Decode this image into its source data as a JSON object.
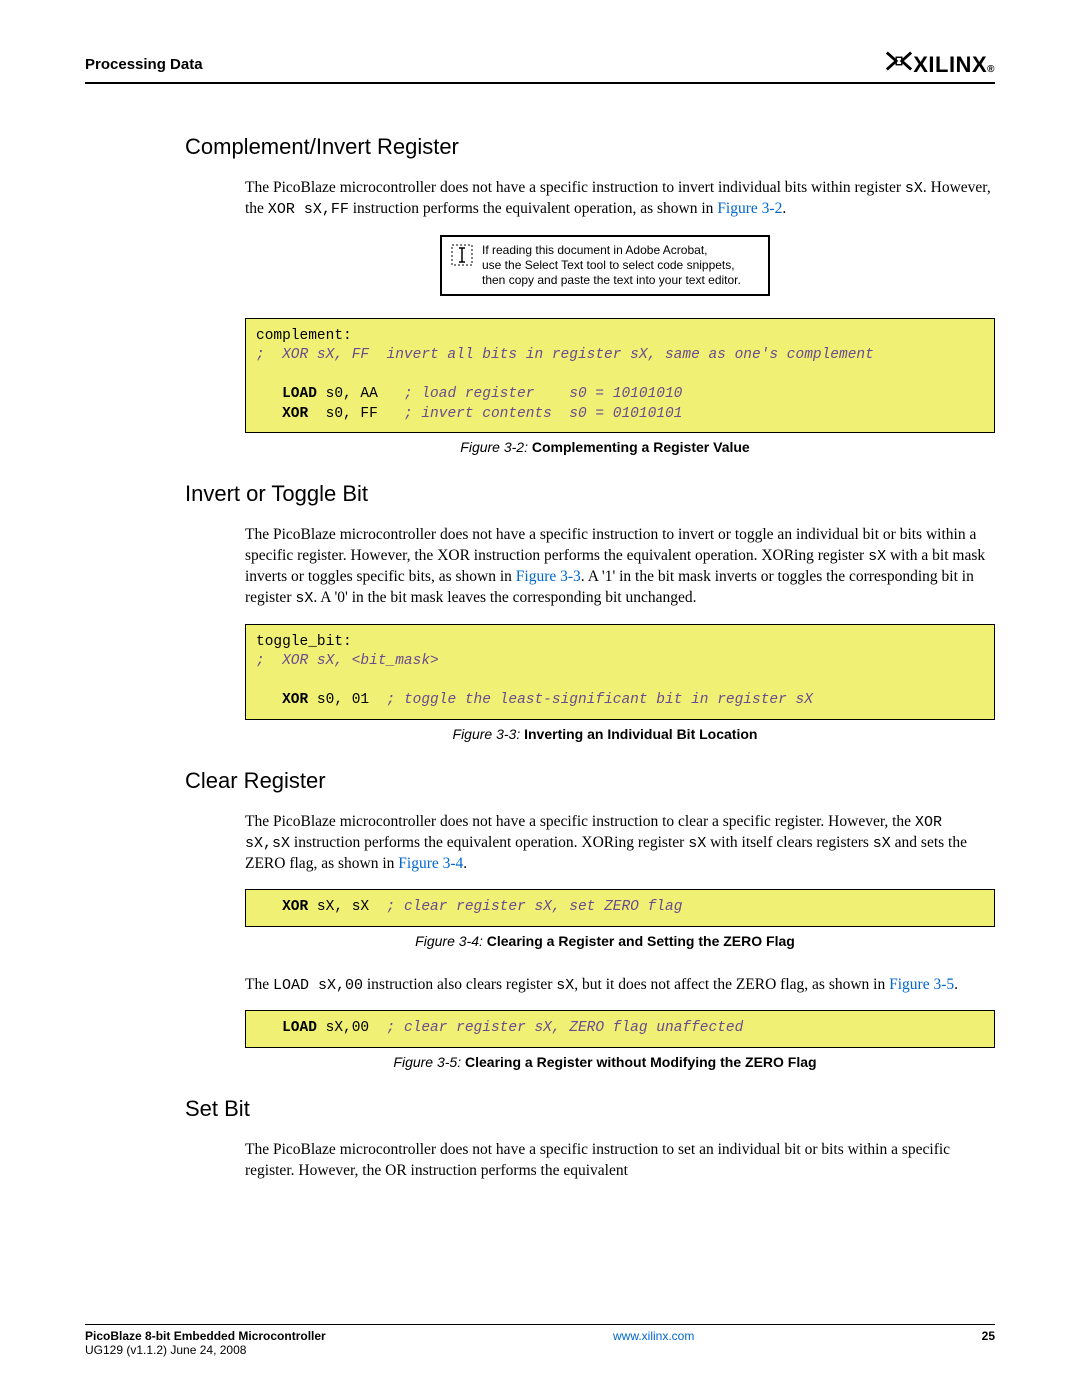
{
  "header": {
    "section": "Processing Data",
    "brand": "XILINX",
    "reg": "®"
  },
  "hint": {
    "l1": "If reading this document in Adobe Acrobat,",
    "l2": "use the Select Text tool to select code snippets,",
    "l3": "then copy and paste the text into your text editor."
  },
  "sections": {
    "s1": {
      "title": "Complement/Invert Register",
      "p1a": "The PicoBlaze microcontroller does not have a specific instruction to invert individual bits within register ",
      "p1b": "sX",
      "p1c": ". However, the ",
      "p1d": "XOR sX,FF",
      "p1e": " instruction performs the equivalent operation, as shown in ",
      "p1f": "Figure 3-2",
      "p1g": ".",
      "c1": "complement:",
      "c2": ";  XOR sX, FF  invert all bits in register sX, same as one's complement",
      "c3a": "LOAD",
      "c3b": " s0, AA   ",
      "c3c": "; load register    s0 = 10101010",
      "c4a": "XOR",
      "c4b": "  s0, FF   ",
      "c4c": "; invert contents  s0 = 01010101",
      "cap_i": "Figure 3-2:",
      "cap_b": "Complementing a Register Value"
    },
    "s2": {
      "title": "Invert or Toggle Bit",
      "p1a": "The PicoBlaze microcontroller does not have a specific instruction to invert or toggle an individual bit or bits within a specific register. However, the XOR instruction performs the equivalent operation. XORing register ",
      "p1b": "sX",
      "p1c": " with a bit mask inverts or toggles specific bits, as shown in ",
      "p1d": "Figure 3-3",
      "p1e": ". A '1' in the bit mask inverts or toggles the corresponding bit in register ",
      "p1f": "sX",
      "p1g": ". A '0' in the bit mask leaves the corresponding bit unchanged.",
      "c1": "toggle_bit:",
      "c2": ";  XOR sX, <bit_mask>",
      "c3a": "XOR",
      "c3b": " s0, 01  ",
      "c3c": "; toggle the least-significant bit in register sX",
      "cap_i": "Figure 3-3:",
      "cap_b": "Inverting an Individual Bit Location"
    },
    "s3": {
      "title": "Clear Register",
      "p1a": "The PicoBlaze microcontroller does not have a specific instruction to clear a specific register. However, the ",
      "p1b": "XOR sX,sX",
      "p1c": " instruction performs the equivalent operation. XORing register ",
      "p1d": "sX",
      "p1e": " with itself clears registers ",
      "p1f": "sX",
      "p1g": " and sets the ZERO flag, as shown in ",
      "p1h": "Figure 3-4",
      "p1i": ".",
      "c1a": "XOR",
      "c1b": " sX, sX  ",
      "c1c": "; clear register sX, set ZERO flag",
      "cap1_i": "Figure 3-4:",
      "cap1_b": "Clearing a Register and Setting the ZERO Flag",
      "p2a": "The ",
      "p2b": "LOAD sX,00",
      "p2c": " instruction also clears register ",
      "p2d": "sX",
      "p2e": ", but it does not affect the ZERO flag, as shown in ",
      "p2f": "Figure 3-5",
      "p2g": ".",
      "c2a": "LOAD",
      "c2b": " sX,00  ",
      "c2c": "; clear register sX, ZERO flag unaffected",
      "cap2_i": "Figure 3-5:",
      "cap2_b": "Clearing a Register without Modifying the ZERO Flag"
    },
    "s4": {
      "title": "Set Bit",
      "p1": "The PicoBlaze microcontroller does not have a specific instruction to set an individual bit or bits within a specific register. However, the OR instruction performs the equivalent"
    }
  },
  "footer": {
    "doc": "PicoBlaze 8-bit Embedded Microcontroller",
    "ver": "UG129 (v1.1.2) June 24, 2008",
    "url": "www.xilinx.com",
    "page": "25"
  }
}
